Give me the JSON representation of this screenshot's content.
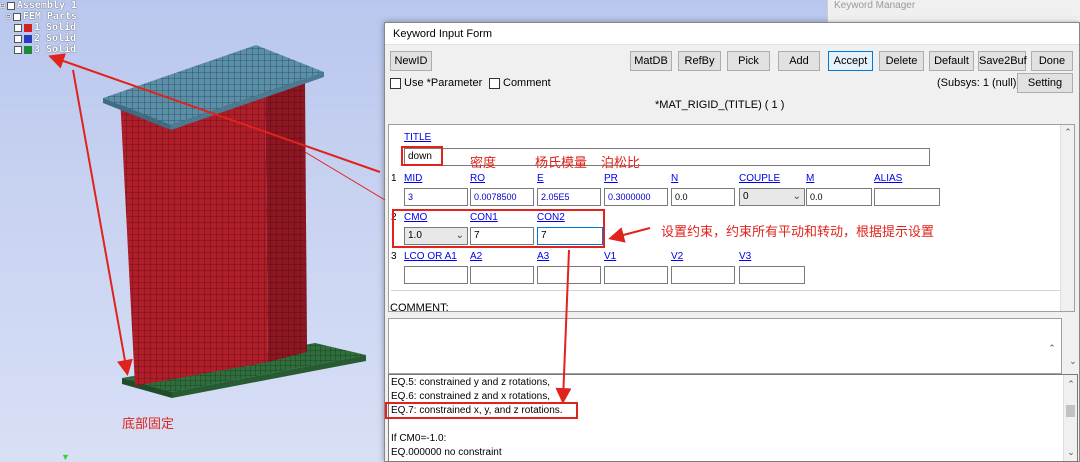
{
  "tree": {
    "root": "Assembly 1",
    "group": "FEM Parts",
    "items": [
      {
        "label": "1 Solid",
        "color": "#d42020"
      },
      {
        "label": "2 Solid",
        "color": "#2a3ab8"
      },
      {
        "label": "3 Solid",
        "color": "#1e8a36"
      }
    ]
  },
  "keyword_manager": {
    "title": "Keyword Manager"
  },
  "dialog": {
    "title": "Keyword Input Form",
    "buttons": {
      "newid": "NewID",
      "matdb": "MatDB",
      "refby": "RefBy",
      "pick": "Pick",
      "add": "Add",
      "accept": "Accept",
      "delete": "Delete",
      "default": "Default",
      "save2buf": "Save2Buf",
      "done": "Done",
      "setting": "Setting"
    },
    "use_parameter": "Use *Parameter",
    "comment_check": "Comment",
    "subsys": "(Subsys: 1 (null))",
    "keyword": "*MAT_RIGID_(TITLE)   ( 1 )",
    "title_label": "TITLE",
    "title_value": "down",
    "rows": [
      {
        "num": "1",
        "fields": [
          {
            "label": "MID",
            "value": "3"
          },
          {
            "label": "RO",
            "value": "0.0078500"
          },
          {
            "label": "E",
            "value": "2.05E5"
          },
          {
            "label": "PR",
            "value": "0.3000000"
          },
          {
            "label": "N",
            "value": "0.0"
          },
          {
            "label": "COUPLE",
            "value": "0"
          },
          {
            "label": "M",
            "value": "0.0"
          },
          {
            "label": "ALIAS",
            "value": ""
          }
        ]
      },
      {
        "num": "2",
        "fields": [
          {
            "label": "CMO",
            "value": "1.0"
          },
          {
            "label": "CON1",
            "value": "7"
          },
          {
            "label": "CON2",
            "value": "7"
          }
        ]
      },
      {
        "num": "3",
        "fields": [
          {
            "label": "LCO OR A1",
            "value": ""
          },
          {
            "label": "A2",
            "value": ""
          },
          {
            "label": "A3",
            "value": ""
          },
          {
            "label": "V1",
            "value": ""
          },
          {
            "label": "V2",
            "value": ""
          },
          {
            "label": "V3",
            "value": ""
          }
        ]
      }
    ],
    "comment_label": "COMMENT:",
    "help_lines": [
      "EQ.5: constrained y and z rotations,",
      "EQ.6: constrained z and x rotations,",
      "EQ.7: constrained x, y, and z rotations.",
      "",
      "If CM0=-1.0:",
      "EQ.000000 no constraint"
    ]
  },
  "annotations": {
    "density": "密度",
    "youngs_modulus": "杨氏模量",
    "poisson_ratio": "泊松比",
    "constraint_note": "设置约束，约束所有平动和转动，根据提示设置",
    "bottom_fixed": "底部固定"
  },
  "colors": {
    "annotation_red": "#e0231c",
    "wall_red": "#b01e2a",
    "top_plate": "#5b8fa8",
    "bottom_plate": "#2f6e3c"
  }
}
